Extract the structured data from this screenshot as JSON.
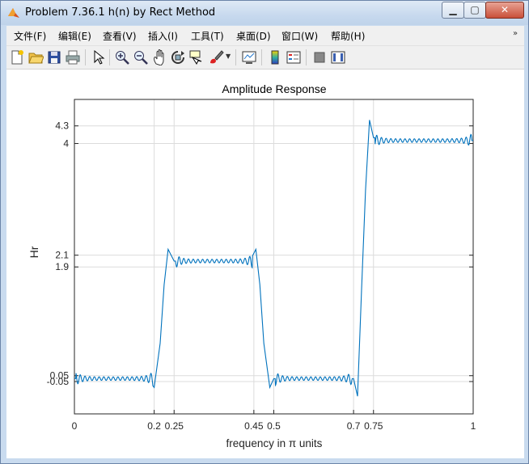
{
  "window": {
    "title": "Problem 7.36.1 h(n) by Rect Method",
    "app_icon": "matlab-icon",
    "controls": {
      "minimize": "minimize-icon",
      "maximize": "maximize-icon",
      "close": "close-icon"
    }
  },
  "menubar": {
    "items": [
      "文件(F)",
      "编辑(E)",
      "查看(V)",
      "插入(I)",
      "工具(T)",
      "桌面(D)",
      "窗口(W)",
      "帮助(H)"
    ],
    "overflow_icon": "chevron-double-icon"
  },
  "toolbar": {
    "buttons": [
      "new-figure-icon",
      "open-icon",
      "save-icon",
      "print-icon",
      "pointer-icon",
      "zoom-in-icon",
      "zoom-out-icon",
      "pan-icon",
      "rotate-3d-icon",
      "data-cursor-icon",
      "brush-icon",
      "link-plot-icon",
      "colorbar-icon",
      "legend-icon",
      "hide-plot-tools-icon",
      "show-plot-tools-icon"
    ]
  },
  "chart_data": {
    "type": "line",
    "title": "Amplitude Response",
    "xlabel": "frequency in π units",
    "ylabel": "Hr",
    "xlim": [
      0,
      1
    ],
    "ylim": [
      -0.6,
      4.75
    ],
    "xticks": [
      0,
      0.2,
      0.25,
      0.45,
      0.5,
      0.7,
      0.75,
      1
    ],
    "xtick_labels": [
      "0",
      "0.2",
      "0.25",
      "0.45",
      "0.5",
      "0.7",
      "0.75",
      "1"
    ],
    "yticks": [
      -0.05,
      0.05,
      1.9,
      2.1,
      4,
      4.3
    ],
    "ytick_labels": [
      "-0.05",
      "0.05",
      "1.9",
      "2.1",
      "4",
      "4.3"
    ],
    "grid": true,
    "series": [
      {
        "color": "#0072bd",
        "x": [
          0,
          0.18,
          0.2,
          0.215,
          0.225,
          0.235,
          0.25,
          0.44,
          0.455,
          0.465,
          0.475,
          0.49,
          0.5,
          0.7,
          0.71,
          0.72,
          0.73,
          0.74,
          0.75,
          1
        ],
        "y": [
          0,
          0.02,
          -0.15,
          0.6,
          1.6,
          2.2,
          2.0,
          2.0,
          2.2,
          1.6,
          0.6,
          -0.15,
          0.0,
          0.0,
          -0.3,
          1.5,
          3.2,
          4.4,
          4.1,
          4.05
        ]
      }
    ]
  }
}
